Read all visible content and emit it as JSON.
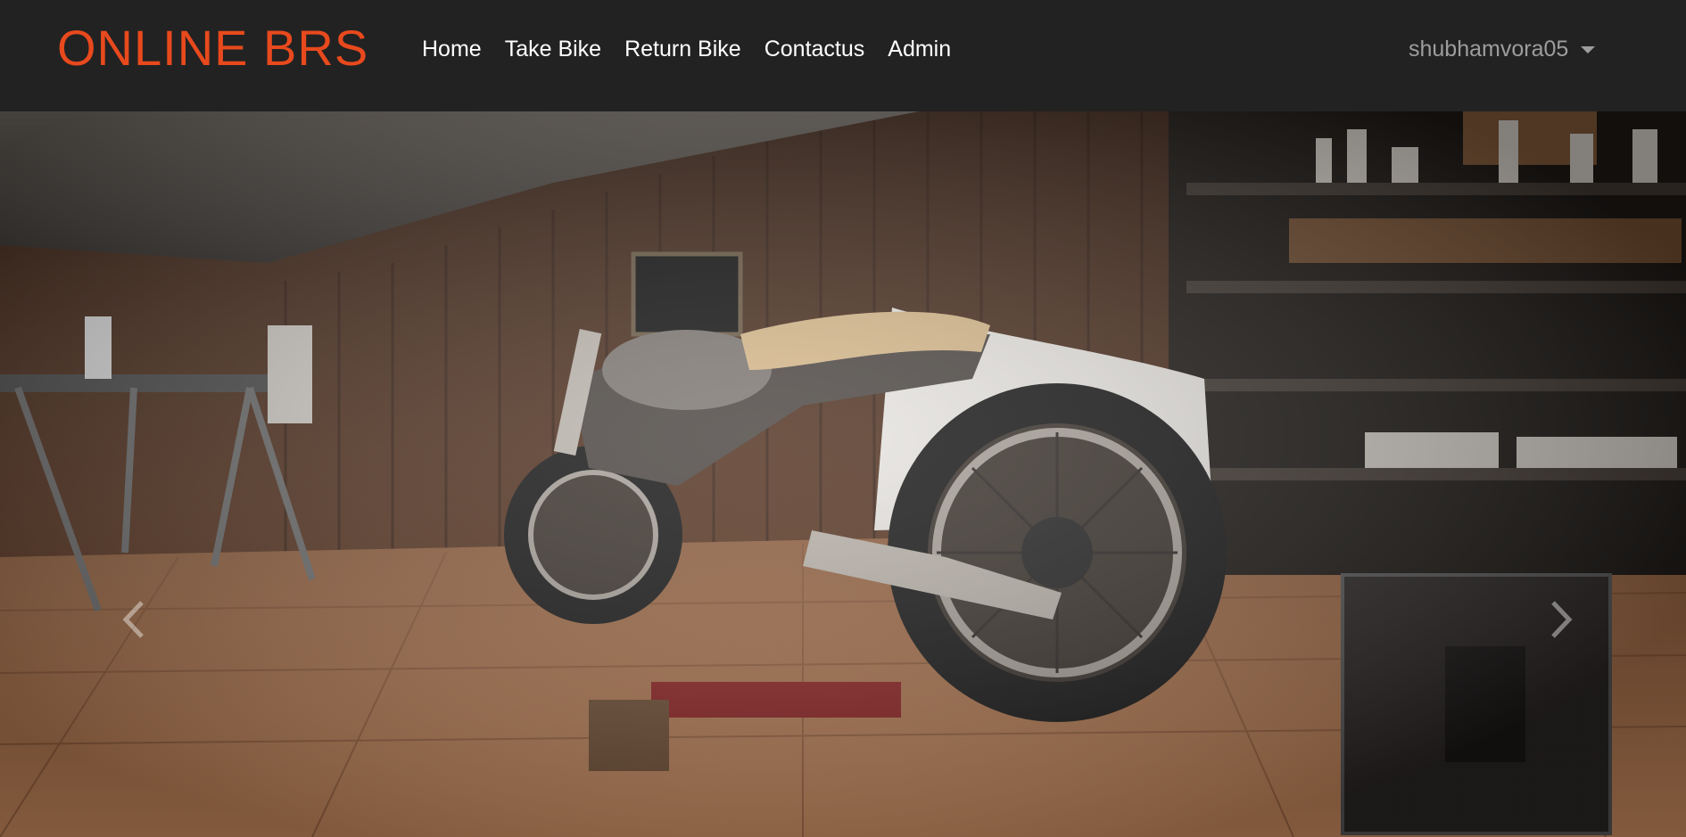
{
  "navbar": {
    "brand": "ONLINE BRS",
    "links": [
      {
        "label": "Home"
      },
      {
        "label": "Take Bike"
      },
      {
        "label": "Return Bike"
      },
      {
        "label": "Contactus"
      },
      {
        "label": "Admin"
      }
    ],
    "user": {
      "name": "shubhamvora05",
      "icon": "caret-down-icon"
    }
  },
  "carousel": {
    "image_subject": "motorcycle-garage-photo",
    "prev_icon": "chevron-left-icon",
    "next_icon": "chevron-right-icon"
  },
  "colors": {
    "navbar_bg": "#222222",
    "brand": "#e8491d",
    "nav_link": "#ffffff",
    "user_text": "#9d9d9d"
  }
}
